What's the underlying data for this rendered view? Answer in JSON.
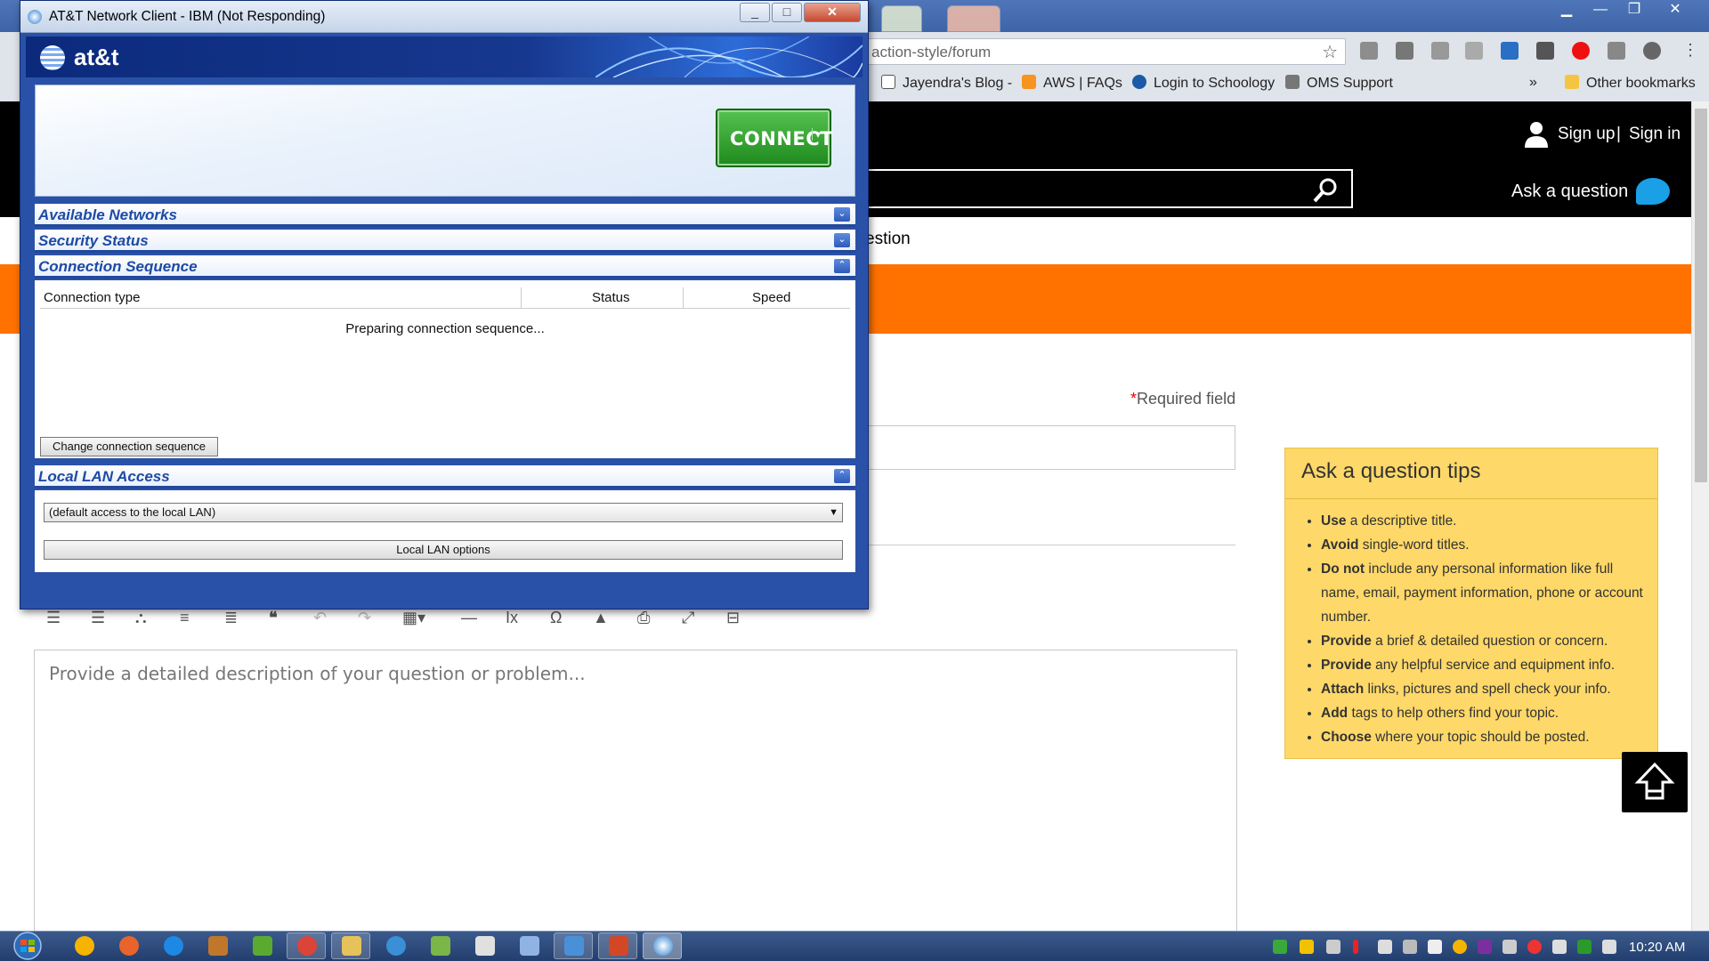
{
  "browser": {
    "url_partial": "action-style/forum",
    "bookmarks": [
      "Jayendra's Blog -",
      "AWS | FAQs",
      "Login to Schoology",
      "OMS Support"
    ],
    "bookmarks_more": "»",
    "other_bookmarks": "Other bookmarks"
  },
  "site": {
    "sign_up": "Sign up",
    "separator": "|",
    "sign_in": "Sign in",
    "ask_question": "Ask a question",
    "nav_partial": "estion",
    "required_field": "Required field",
    "editor_placeholder": "Provide a detailed description of your question or problem...",
    "tips": {
      "title": "Ask a question tips",
      "items": [
        {
          "bold": "Use",
          "text": " a descriptive title."
        },
        {
          "bold": "Avoid",
          "text": " single-word titles."
        },
        {
          "bold": "Do not",
          "text": " include any personal information like full name, email, payment information, phone or account number."
        },
        {
          "bold": "Provide",
          "text": " a brief & detailed question or concern."
        },
        {
          "bold": "Provide",
          "text": " any helpful service and equipment info."
        },
        {
          "bold": "Attach",
          "text": " links, pictures and spell check your info."
        },
        {
          "bold": "Add",
          "text": " tags to help others find your topic."
        },
        {
          "bold": "Choose",
          "text": " where your topic should be posted."
        }
      ]
    }
  },
  "att": {
    "window_title": "AT&T Network Client - IBM (Not Responding)",
    "logo_text": "at&t",
    "connect_label": "CONNECT",
    "sections": {
      "available_networks": "Available Networks",
      "security_status": "Security Status",
      "connection_sequence": "Connection Sequence",
      "local_lan_access": "Local LAN Access"
    },
    "columns": {
      "connection_type": "Connection type",
      "status": "Status",
      "speed": "Speed"
    },
    "preparing": "Preparing connection sequence...",
    "change_sequence": "Change connection sequence",
    "lan_select_value": "(default access to the local LAN)",
    "lan_options": "Local LAN options"
  },
  "taskbar": {
    "clock": "10:20 AM"
  },
  "colors": {
    "orange_band": "#ff7200",
    "tips_bg": "#fed868",
    "att_blue": "#2a51a8",
    "connect_green": "#2a9a2a"
  },
  "icons": [
    "search-icon",
    "user-icon",
    "chat-bubble-icon",
    "star-icon",
    "scroll-to-top-icon",
    "windows-start-icon"
  ]
}
